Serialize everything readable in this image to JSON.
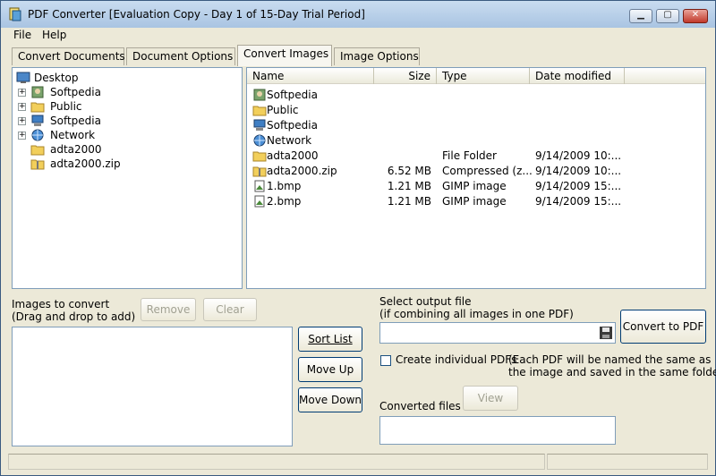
{
  "window": {
    "title": "PDF Converter [Evaluation Copy - Day 1 of 15-Day Trial Period]"
  },
  "menu": {
    "file": "File",
    "help": "Help"
  },
  "tabs": [
    {
      "label": "Convert Documents"
    },
    {
      "label": "Document Options"
    },
    {
      "label": "Convert Images"
    },
    {
      "label": "Image Options"
    }
  ],
  "tree": {
    "root": "Desktop",
    "items": [
      {
        "label": "Softpedia",
        "icon": "user-icon"
      },
      {
        "label": "Public",
        "icon": "folder-icon"
      },
      {
        "label": "Softpedia",
        "icon": "computer-icon"
      },
      {
        "label": "Network",
        "icon": "network-icon"
      },
      {
        "label": "adta2000",
        "icon": "folder-icon"
      },
      {
        "label": "adta2000.zip",
        "icon": "zip-icon"
      }
    ]
  },
  "filelist": {
    "headers": {
      "name": "Name",
      "size": "Size",
      "type": "Type",
      "date": "Date modified"
    },
    "rows": [
      {
        "name": "Softpedia",
        "size": "",
        "type": "",
        "date": ""
      },
      {
        "name": "Public",
        "size": "",
        "type": "",
        "date": ""
      },
      {
        "name": "Softpedia",
        "size": "",
        "type": "",
        "date": ""
      },
      {
        "name": "Network",
        "size": "",
        "type": "",
        "date": ""
      },
      {
        "name": "adta2000",
        "size": "",
        "type": "File Folder",
        "date": "9/14/2009 10:..."
      },
      {
        "name": "adta2000.zip",
        "size": "6.52 MB",
        "type": "Compressed (z...",
        "date": "9/14/2009 10:..."
      },
      {
        "name": "1.bmp",
        "size": "1.21 MB",
        "type": "GIMP image",
        "date": "9/14/2009 15:..."
      },
      {
        "name": "2.bmp",
        "size": "1.21 MB",
        "type": "GIMP image",
        "date": "9/14/2009 15:..."
      }
    ]
  },
  "images_panel": {
    "title": "Images to convert",
    "subtitle": "(Drag and drop to add)",
    "remove": "Remove",
    "clear": "Clear"
  },
  "list_buttons": {
    "sort": "Sort List",
    "up": "Move Up",
    "down": "Move Down"
  },
  "output": {
    "label": "Select output file",
    "sublabel": "(if combining all images in one PDF)",
    "value": "",
    "convert": "Convert to PDF",
    "checkbox_label": "Create individual PDFs",
    "note_line1": "(Each PDF will be named the same as",
    "note_line2": "the image and saved in the same folder)",
    "converted_label": "Converted files",
    "view": "View"
  }
}
